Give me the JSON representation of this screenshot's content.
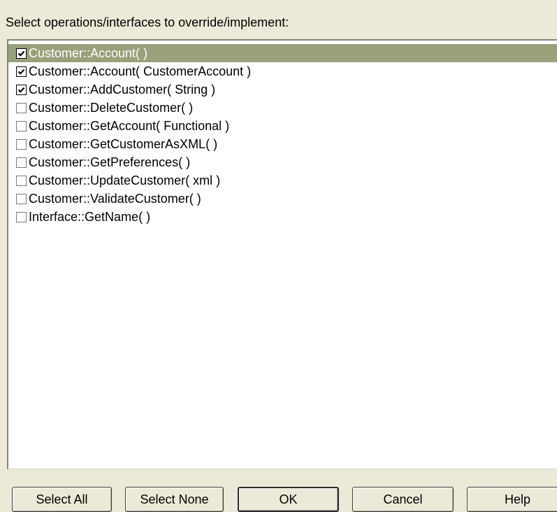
{
  "prompt": "Select operations/interfaces to override/implement:",
  "items": [
    {
      "label": "Customer::Account( )",
      "checked": true,
      "selected": true
    },
    {
      "label": "Customer::Account( CustomerAccount )",
      "checked": true,
      "selected": false
    },
    {
      "label": "Customer::AddCustomer( String )",
      "checked": true,
      "selected": false
    },
    {
      "label": "Customer::DeleteCustomer( )",
      "checked": false,
      "selected": false
    },
    {
      "label": "Customer::GetAccount( Functional )",
      "checked": false,
      "selected": false
    },
    {
      "label": "Customer::GetCustomerAsXML( )",
      "checked": false,
      "selected": false
    },
    {
      "label": "Customer::GetPreferences( )",
      "checked": false,
      "selected": false
    },
    {
      "label": "Customer::UpdateCustomer( xml )",
      "checked": false,
      "selected": false
    },
    {
      "label": "Customer::ValidateCustomer( )",
      "checked": false,
      "selected": false
    },
    {
      "label": "Interface::GetName( )",
      "checked": false,
      "selected": false
    }
  ],
  "buttons": {
    "select_all": "Select All",
    "select_none": "Select None",
    "ok": "OK",
    "cancel": "Cancel",
    "help": "Help"
  },
  "colors": {
    "dialog_bg": "#ece9d8",
    "selection_bg": "#98a17a",
    "selection_text": "#ffffff"
  }
}
